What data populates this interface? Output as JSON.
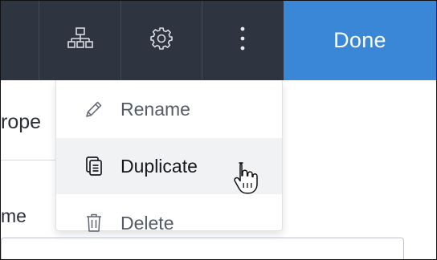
{
  "toolbar": {
    "icons": [
      "sitemap-icon",
      "gear-icon",
      "more-vertical-icon"
    ],
    "done_label": "Done"
  },
  "content": {
    "heading_fragment": "rope",
    "field_label_fragment": "me"
  },
  "menu": {
    "items": [
      {
        "label": "Rename",
        "icon": "pencil-icon"
      },
      {
        "label": "Duplicate",
        "icon": "copy-icon"
      },
      {
        "label": "Delete",
        "icon": "trash-icon"
      }
    ],
    "active_index": 1
  },
  "colors": {
    "toolbar_bg": "#2f3540",
    "accent": "#3a87d8",
    "menu_hover": "#f1f2f4"
  }
}
